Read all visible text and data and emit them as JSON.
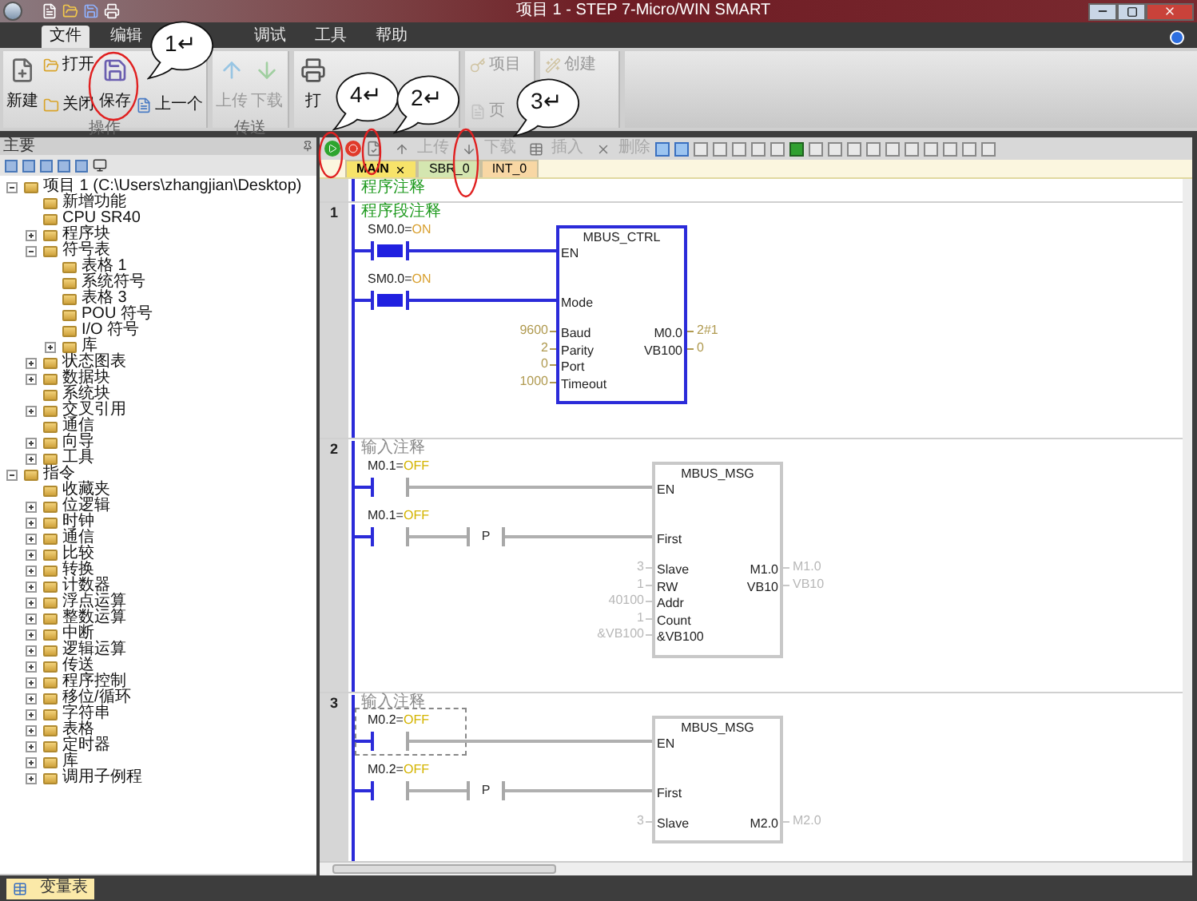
{
  "title_bar": {
    "title": "项目 1 - STEP 7-Micro/WIN SMART"
  },
  "menu_tabs": [
    {
      "label": "文件",
      "selected": true
    },
    {
      "label": "编辑",
      "selected": false
    },
    {
      "label": "调试",
      "selected": false
    },
    {
      "label": "工具",
      "selected": false
    },
    {
      "label": "帮助",
      "selected": false
    }
  ],
  "ribbon": [
    {
      "label": "操作",
      "buttons": [
        {
          "label": "新建",
          "kind": "large",
          "disabled": false
        },
        {
          "label": "打开",
          "kind": "small",
          "disabled": false
        },
        {
          "label": "关闭",
          "kind": "small",
          "disabled": false
        },
        {
          "label": "保存",
          "kind": "large",
          "disabled": false
        },
        {
          "label": "上一个",
          "kind": "small",
          "disabled": false
        }
      ]
    },
    {
      "label": "传送",
      "buttons": [
        {
          "label": "上传",
          "kind": "large",
          "disabled": true
        },
        {
          "label": "下载",
          "kind": "large",
          "disabled": true
        }
      ]
    },
    {
      "buttons": [
        {
          "label": "打",
          "kind": "large",
          "disabled": false
        }
      ]
    },
    {
      "buttons": [
        {
          "label": "项目",
          "kind": "small",
          "disabled": true
        },
        {
          "label": "页",
          "kind": "small",
          "disabled": true
        }
      ]
    },
    {
      "buttons": [
        {
          "label": "创建",
          "kind": "small",
          "disabled": true
        }
      ]
    }
  ],
  "callouts": [
    {
      "label": "1↵"
    },
    {
      "label": "4↵"
    },
    {
      "label": "2↵"
    },
    {
      "label": "3↵"
    }
  ],
  "sidebar": {
    "title": "主要",
    "tree": [
      {
        "label": "项目 1 (C:\\Users\\zhangjian\\Desktop)",
        "expanded": true,
        "children": [
          {
            "label": "新增功能"
          },
          {
            "label": "CPU SR40"
          },
          {
            "label": "程序块",
            "expanded": false
          },
          {
            "label": "符号表",
            "expanded": true,
            "children": [
              {
                "label": "表格 1"
              },
              {
                "label": "系统符号"
              },
              {
                "label": "表格 3"
              },
              {
                "label": "POU 符号"
              },
              {
                "label": "I/O 符号"
              },
              {
                "label": "库",
                "expanded": false
              }
            ]
          },
          {
            "label": "状态图表",
            "expanded": false
          },
          {
            "label": "数据块",
            "expanded": false
          },
          {
            "label": "系统块"
          },
          {
            "label": "交叉引用",
            "expanded": false
          },
          {
            "label": "通信"
          },
          {
            "label": "向导",
            "expanded": false
          },
          {
            "label": "工具",
            "expanded": false
          }
        ]
      },
      {
        "label": "指令",
        "expanded": true,
        "children": [
          {
            "label": "收藏夹"
          },
          {
            "label": "位逻辑",
            "expanded": false
          },
          {
            "label": "时钟",
            "expanded": false
          },
          {
            "label": "通信",
            "expanded": false
          },
          {
            "label": "比较",
            "expanded": false
          },
          {
            "label": "转换",
            "expanded": false
          },
          {
            "label": "计数器",
            "expanded": false
          },
          {
            "label": "浮点运算",
            "expanded": false
          },
          {
            "label": "整数运算",
            "expanded": false
          },
          {
            "label": "中断",
            "expanded": false
          },
          {
            "label": "逻辑运算",
            "expanded": false
          },
          {
            "label": "传送",
            "expanded": false
          },
          {
            "label": "程序控制",
            "expanded": false
          },
          {
            "label": "移位/循环",
            "expanded": false
          },
          {
            "label": "字符串",
            "expanded": false
          },
          {
            "label": "表格",
            "expanded": false
          },
          {
            "label": "定时器",
            "expanded": false
          },
          {
            "label": "库",
            "expanded": false
          },
          {
            "label": "调用子例程",
            "expanded": false
          }
        ]
      }
    ]
  },
  "editor": {
    "toolbar": [
      {
        "label": "上传",
        "disabled": true
      },
      {
        "label": "下载",
        "disabled": true
      },
      {
        "label": "插入",
        "disabled": true
      },
      {
        "label": "删除",
        "disabled": true
      }
    ],
    "tabs": [
      {
        "label": "MAIN",
        "selected": true,
        "closable": true
      },
      {
        "label": "SBR_0",
        "selected": false,
        "closable": false
      },
      {
        "label": "INT_0",
        "selected": false,
        "closable": false
      }
    ],
    "program_comment": "程序注释",
    "networks": [
      {
        "number": "1",
        "comment": {
          "text": "程序段注释",
          "kind": "note"
        },
        "active": true,
        "rungs": [
          {
            "elements": [
              {
                "kind": "contact",
                "label": "SM0.0=",
                "state": "ON",
                "closed": true,
                "selected": false
              }
            ]
          },
          {
            "elements": [
              {
                "kind": "contact",
                "label": "SM0.0=",
                "state": "ON",
                "closed": true,
                "selected": false
              }
            ]
          }
        ],
        "block": {
          "name": "MBUS_CTRL",
          "enable_pins": [
            "EN",
            "Mode"
          ],
          "inputs": [
            {
              "value": "9600",
              "pin": "Baud"
            },
            {
              "value": "2",
              "pin": "Parity"
            },
            {
              "value": "0",
              "pin": "Port"
            },
            {
              "value": "1000",
              "pin": "Timeout"
            }
          ],
          "outputs": [
            {
              "pin": "M0.0",
              "value": "2#1"
            },
            {
              "pin": "VB100",
              "value": "0"
            }
          ]
        }
      },
      {
        "number": "2",
        "comment": {
          "text": "输入注释",
          "kind": "hint"
        },
        "active": false,
        "rungs": [
          {
            "elements": [
              {
                "kind": "contact",
                "label": "M0.1=",
                "state": "OFF",
                "closed": false,
                "selected": false
              }
            ]
          },
          {
            "elements": [
              {
                "kind": "contact",
                "label": "M0.1=",
                "state": "OFF",
                "closed": false,
                "selected": false
              },
              {
                "kind": "pulse",
                "label": "P"
              }
            ]
          }
        ],
        "block": {
          "name": "MBUS_MSG",
          "enable_pins": [
            "EN",
            "First"
          ],
          "inputs": [
            {
              "value": "3",
              "pin": "Slave"
            },
            {
              "value": "1",
              "pin": "RW"
            },
            {
              "value": "40100",
              "pin": "Addr"
            },
            {
              "value": "1",
              "pin": "Count"
            },
            {
              "value": "&VB100",
              "pin": "&VB100"
            }
          ],
          "outputs": [
            {
              "pin": "M1.0",
              "value": "M1.0"
            },
            {
              "pin": "VB10",
              "value": "VB10"
            }
          ]
        }
      },
      {
        "number": "3",
        "comment": {
          "text": "输入注释",
          "kind": "hint"
        },
        "active": false,
        "rungs": [
          {
            "elements": [
              {
                "kind": "contact",
                "label": "M0.2=",
                "state": "OFF",
                "closed": false,
                "selected": true
              }
            ]
          },
          {
            "elements": [
              {
                "kind": "contact",
                "label": "M0.2=",
                "state": "OFF",
                "closed": false,
                "selected": false
              },
              {
                "kind": "pulse",
                "label": "P"
              }
            ]
          }
        ],
        "block": {
          "name": "MBUS_MSG",
          "enable_pins": [
            "EN",
            "First"
          ],
          "inputs": [
            {
              "value": "3",
              "pin": "Slave"
            }
          ],
          "outputs": [
            {
              "pin": "M2.0",
              "value": "M2.0"
            }
          ]
        }
      }
    ]
  },
  "status_bar": {
    "tabs": [
      {
        "label": "变量表",
        "selected": true
      }
    ]
  }
}
